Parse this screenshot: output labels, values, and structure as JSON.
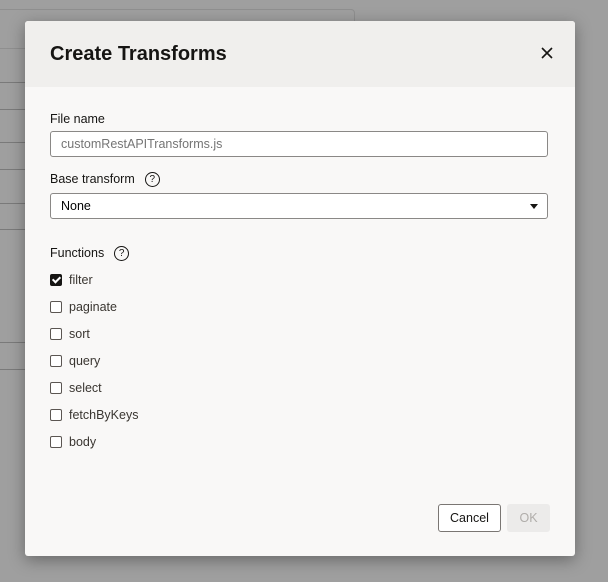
{
  "dialog": {
    "title": "Create Transforms",
    "close_icon": "close-icon",
    "file_name": {
      "label": "File name",
      "value": "",
      "placeholder": "customRestAPITransforms.js"
    },
    "base_transform": {
      "label": "Base transform",
      "help_icon": "help-icon",
      "selected": "None"
    },
    "functions": {
      "label": "Functions",
      "help_icon": "help-icon",
      "items": [
        {
          "label": "filter",
          "checked": true
        },
        {
          "label": "paginate",
          "checked": false
        },
        {
          "label": "sort",
          "checked": false
        },
        {
          "label": "query",
          "checked": false
        },
        {
          "label": "select",
          "checked": false
        },
        {
          "label": "fetchByKeys",
          "checked": false
        },
        {
          "label": "body",
          "checked": false
        }
      ]
    },
    "buttons": {
      "cancel": "Cancel",
      "ok": "OK",
      "ok_disabled": true
    }
  }
}
